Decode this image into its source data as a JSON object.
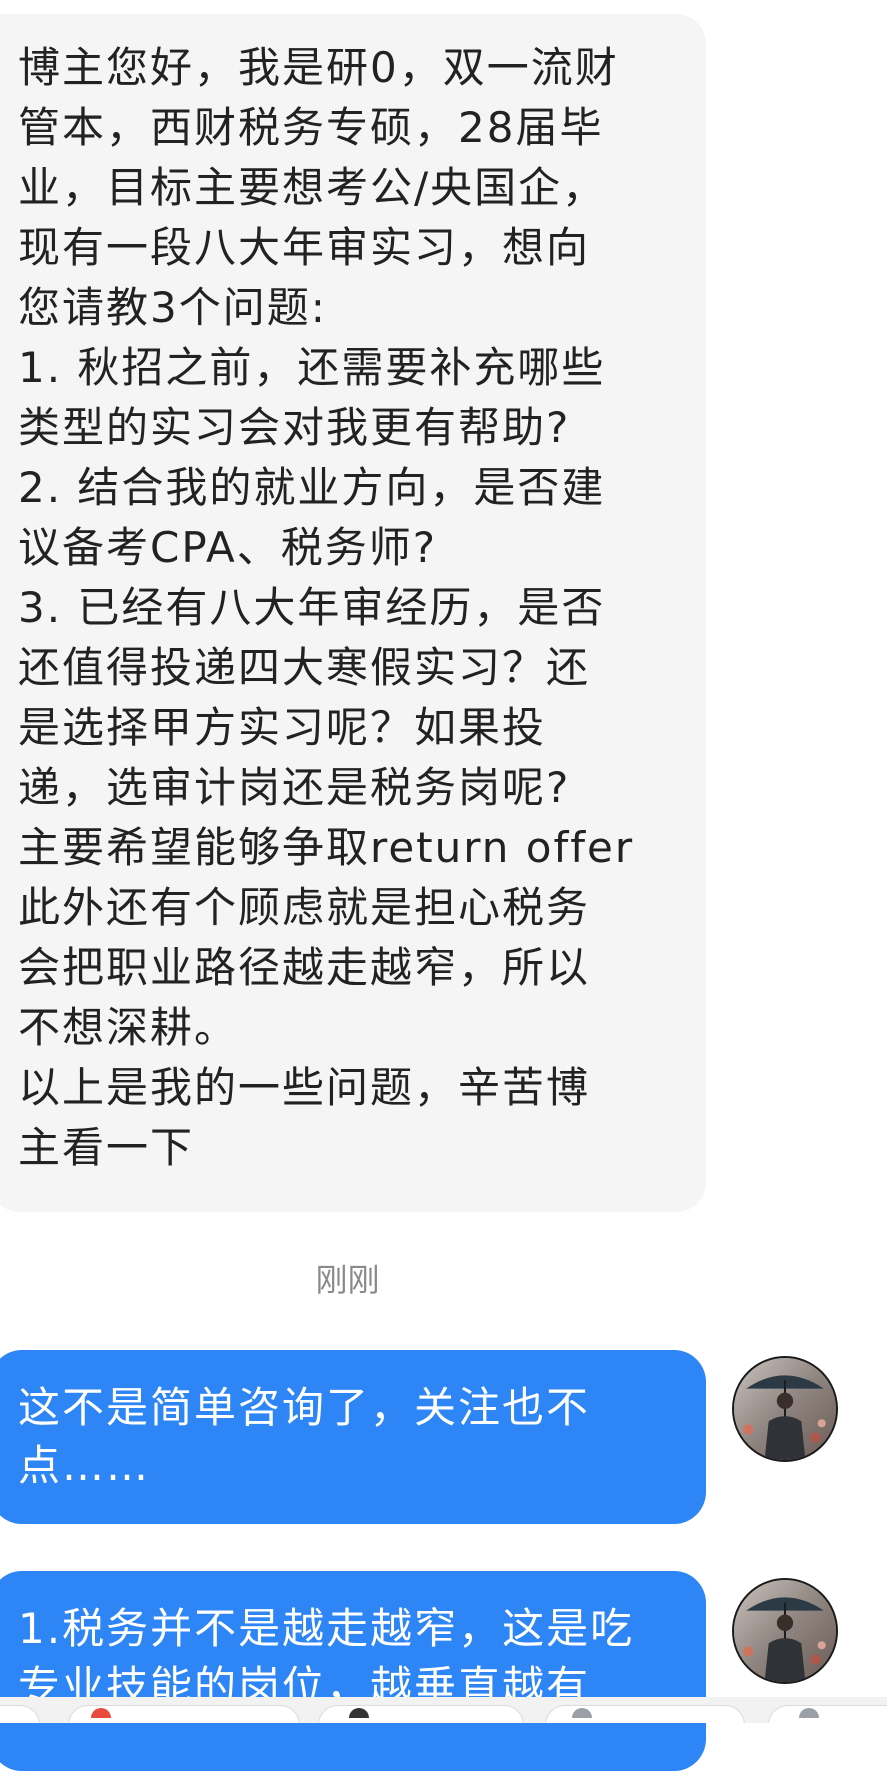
{
  "conversation": {
    "incoming_message": {
      "lines": [
        "博主您好，我是研0，双一流财",
        "管本，西财税务专硕，28届毕",
        "业，目标主要想考公/央国企，",
        "现有一段八大年审实习，想向",
        "您请教3个问题:",
        "1. 秋招之前，还需要补充哪些",
        "类型的实习会对我更有帮助?",
        "2. 结合我的就业方向，是否建",
        "议备考CPA、税务师?",
        "3. 已经有八大年审经历，是否",
        "还值得投递四大寒假实习？还",
        "是选择甲方实习呢？如果投",
        "递，选审计岗还是税务岗呢?",
        "主要希望能够争取return offer",
        "此外还有个顾虑就是担心税务",
        "会把职业路径越走越窄，所以",
        "不想深耕。",
        "以上是我的一些问题，辛苦博",
        "主看一下"
      ]
    },
    "timestamp": "刚刚",
    "reply_1": {
      "lines": [
        "这不是简单咨询了，关注也不",
        "点……"
      ]
    },
    "reply_2": {
      "lines": [
        "1.税务并不是越走越窄，这是吃",
        "专业技能的岗位，越垂直越有"
      ]
    }
  },
  "colors": {
    "incoming_bubble": "#f5f5f5",
    "outgoing_bubble": "#2d85f6",
    "timestamp_text": "#8a8a8a",
    "page_background": "#ffffff"
  },
  "icons": {
    "avatar": "avatar-person-with-umbrella"
  }
}
